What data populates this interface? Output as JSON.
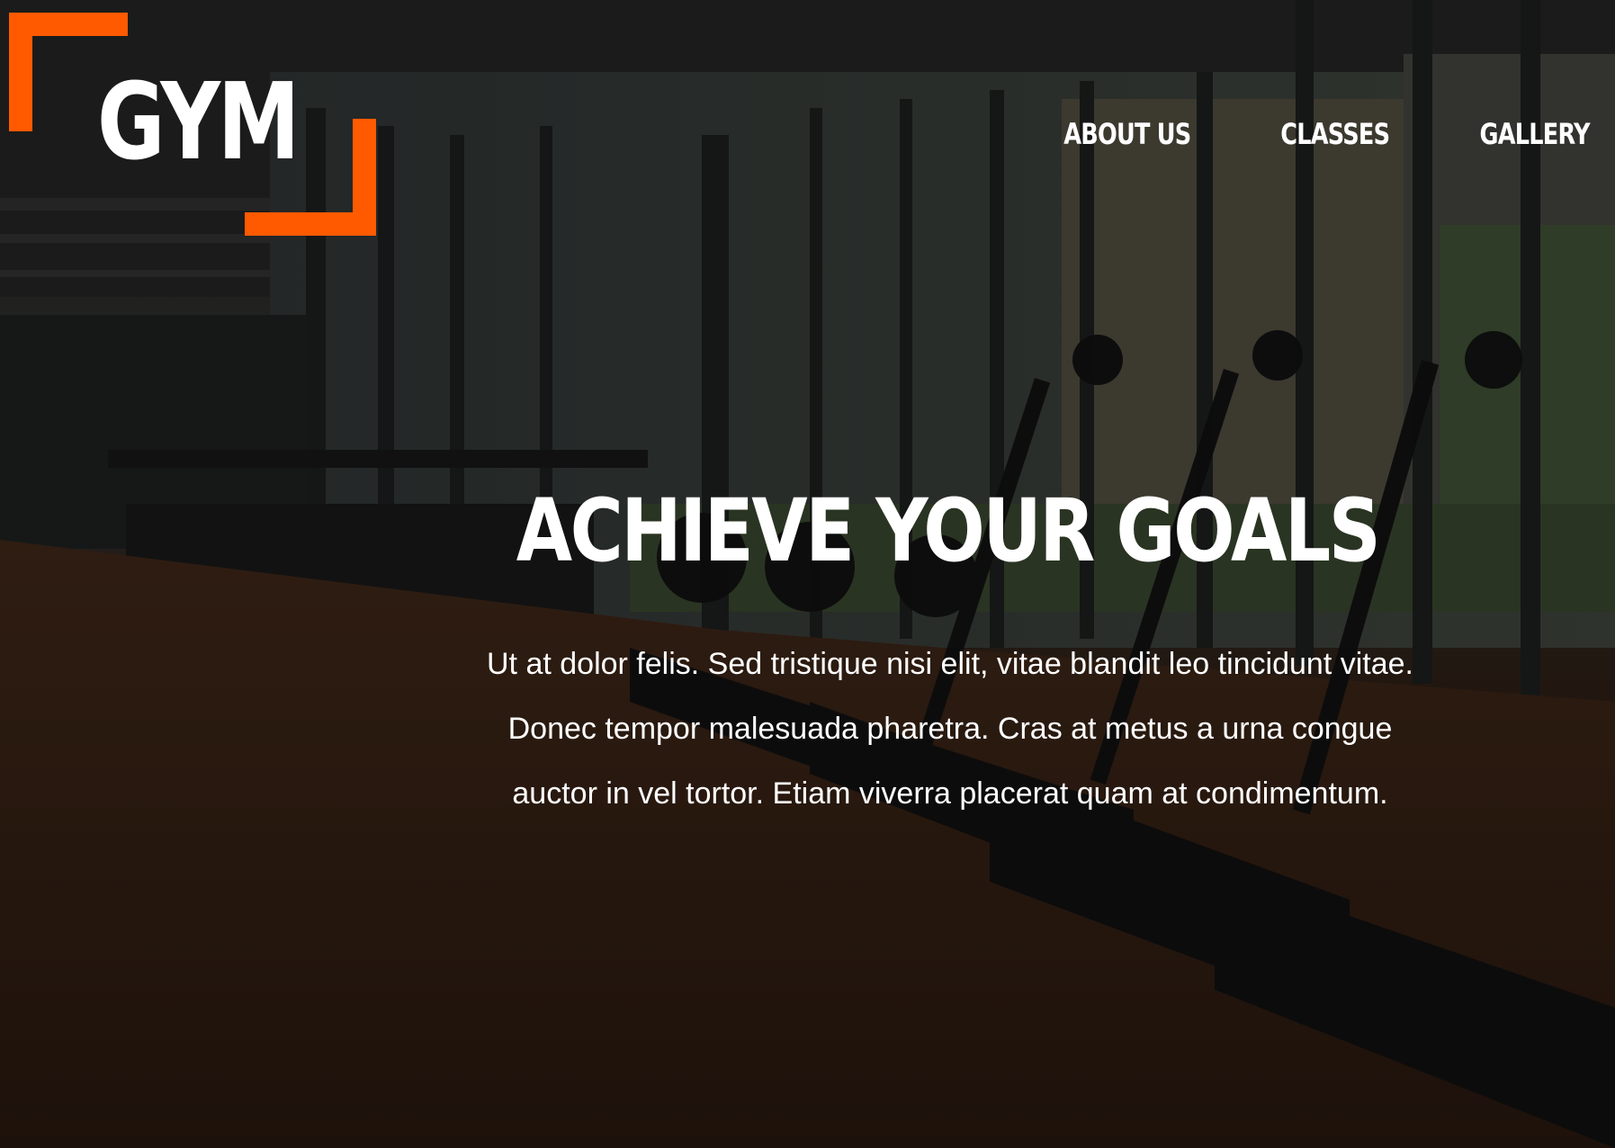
{
  "brand": {
    "logo_text": "GYM",
    "accent_color": "#ff5a00"
  },
  "nav": {
    "items": [
      {
        "label": "ABOUT US"
      },
      {
        "label": "CLASSES"
      },
      {
        "label": "GALLERY"
      }
    ]
  },
  "hero": {
    "headline": "ACHIEVE YOUR GOALS",
    "body": "Ut at dolor felis. Sed tristique nisi elit, vitae blandit leo tincidunt vitae. Donec tempor malesuada pharetra. Cras at metus a urna congue auctor in vel tortor. Etiam viverra placerat quam at condimentum.",
    "background_image": "gym-interior-treadmills-photo"
  }
}
